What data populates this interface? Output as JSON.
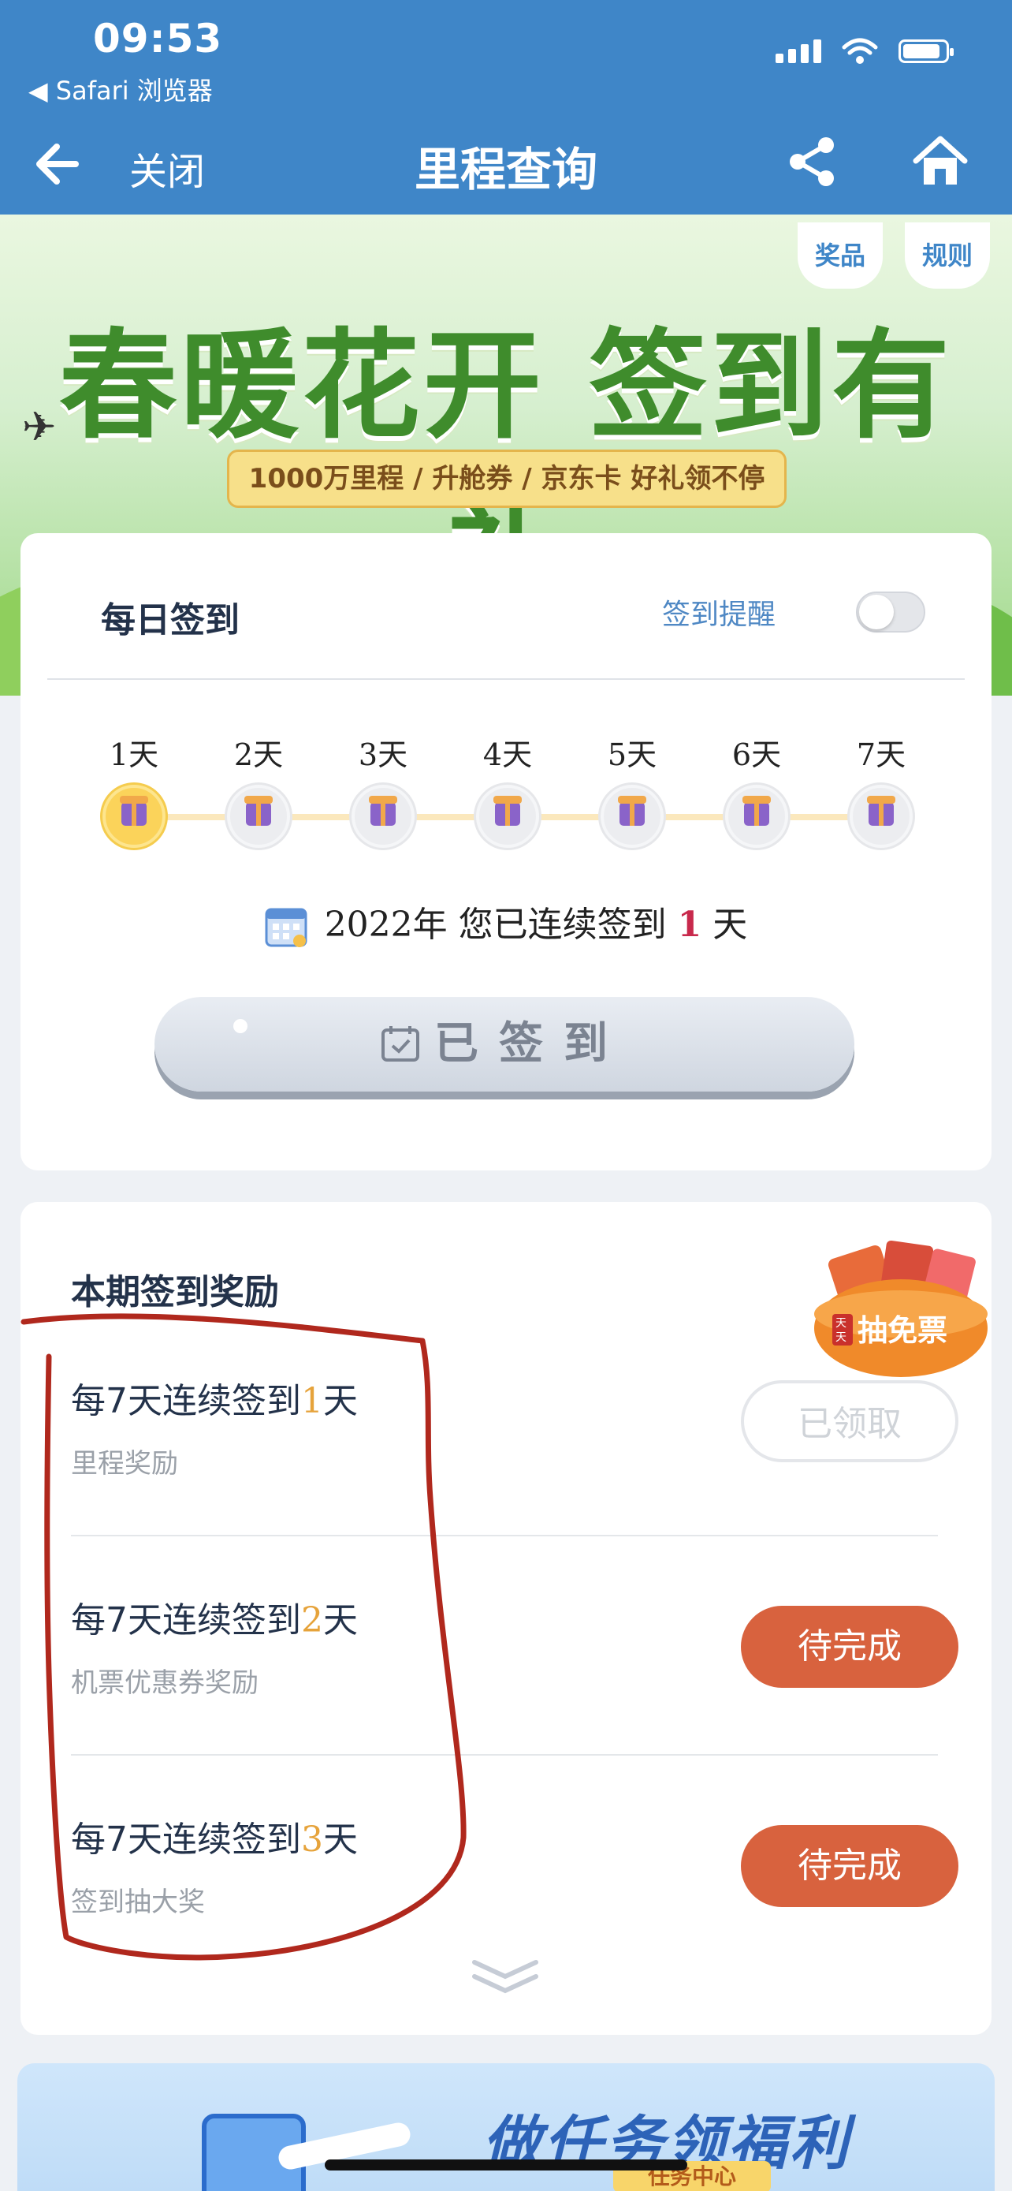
{
  "status_bar": {
    "time": "09:53",
    "back_app": "◀ Safari 浏览器"
  },
  "nav": {
    "close_label": "关闭",
    "title": "里程查询"
  },
  "banner": {
    "title": "春暖花开 签到有礼",
    "subtitle": "1000万里程 / 升舱券 / 京东卡 好礼领不停",
    "prize_button": "奖品",
    "rules_button": "规则"
  },
  "checkin": {
    "title": "每日签到",
    "reminder_label": "签到提醒",
    "reminder_on": false,
    "days": [
      "1天",
      "2天",
      "3天",
      "4天",
      "5天",
      "6天",
      "7天"
    ],
    "checked_days": 1,
    "streak": {
      "year": "2022年",
      "prefix": "您已连续签到",
      "count": "1",
      "suffix": "天"
    },
    "signed_button": "已签到"
  },
  "rewards": {
    "title": "本期签到奖励",
    "lottery_badge": "抽免票",
    "items": [
      {
        "title_prefix": "每7天连续签到",
        "days": "1",
        "title_suffix": "天",
        "subtitle": "里程奖励",
        "button": "已领取",
        "state": "claimed"
      },
      {
        "title_prefix": "每7天连续签到",
        "days": "2",
        "title_suffix": "天",
        "subtitle": "机票优惠券奖励",
        "button": "待完成",
        "state": "pending"
      },
      {
        "title_prefix": "每7天连续签到",
        "days": "3",
        "title_suffix": "天",
        "subtitle": "签到抽大奖",
        "button": "待完成",
        "state": "pending"
      }
    ]
  },
  "bottom_banner": {
    "title": "做任务领福利",
    "tag": "任务中心"
  },
  "colors": {
    "header_blue": "#3f86c8",
    "accent_orange": "#d8623e",
    "streak_red": "#c8294c",
    "day_gold": "#e6a33b",
    "annotation_red": "#b0281d"
  }
}
